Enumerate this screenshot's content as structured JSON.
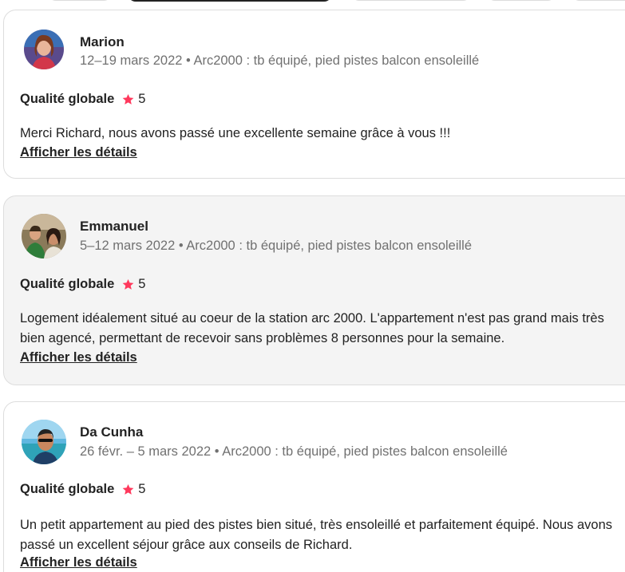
{
  "reviews": [
    {
      "name": "Marion",
      "stay": "12–19 mars 2022 • Arc2000 : tb équipé, pied pistes balcon ensoleillé",
      "rating_label": "Qualité globale",
      "rating_value": "5",
      "text": "Merci Richard, nous avons passé une excellente semaine grâce à vous !!!",
      "details_link": "Afficher les détails"
    },
    {
      "name": "Emmanuel",
      "stay": "5–12 mars 2022 • Arc2000 : tb équipé, pied pistes balcon ensoleillé",
      "rating_label": "Qualité globale",
      "rating_value": "5",
      "text": "Logement idéalement situé au coeur de la station arc 2000. L'appartement n'est pas grand mais très bien agencé, permettant de recevoir sans problèmes 8 personnes pour la semaine.",
      "details_link": "Afficher les détails"
    },
    {
      "name": "Da Cunha",
      "stay": "26 févr. – 5 mars 2022 • Arc2000 : tb équipé, pied pistes balcon ensoleillé",
      "rating_label": "Qualité globale",
      "rating_value": "5",
      "text": "Un petit appartement au pied des pistes bien situé, très ensoleillé et parfaitement équipé. Nous avons passé un excellent séjour grâce aux conseils de Richard.",
      "details_link": "Afficher les détails"
    }
  ],
  "colors": {
    "star": "#ff385c",
    "muted_text": "#717171",
    "card_border": "#dddddd",
    "card_highlight_bg": "#f4f4f4"
  },
  "icons": {
    "rating": "star-icon"
  }
}
